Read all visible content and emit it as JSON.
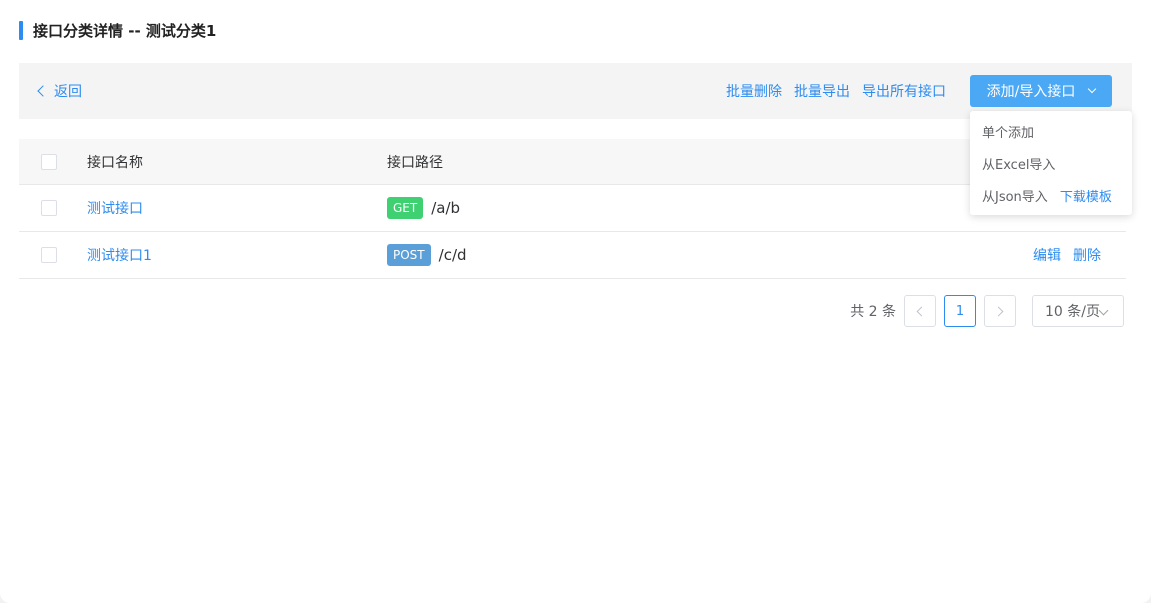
{
  "page": {
    "title": "接口分类详情 -- 测试分类1"
  },
  "toolbar": {
    "back_label": "返回",
    "batch_delete": "批量删除",
    "batch_export": "批量导出",
    "export_all": "导出所有接口",
    "add_import_button": "添加/导入接口"
  },
  "dropdown": {
    "items": [
      {
        "label": "单个添加"
      },
      {
        "label": "从Excel导入"
      },
      {
        "label": "从Json导入",
        "extra": "下载模板"
      }
    ]
  },
  "table": {
    "headers": [
      "接口名称",
      "接口路径"
    ],
    "rows": [
      {
        "name": "测试接口",
        "method": "GET",
        "path": "/a/b",
        "actions": []
      },
      {
        "name": "测试接口1",
        "method": "POST",
        "path": "/c/d",
        "actions": [
          "编辑",
          "删除"
        ]
      }
    ]
  },
  "pagination": {
    "total_text": "共 2 条",
    "current_page": "1",
    "page_size": "10 条/页"
  },
  "colors": {
    "accent": "#2d8cf0",
    "primary_button": "#4ba8f5",
    "get_method": "#3fd171",
    "post_method": "#5b9fd8"
  }
}
